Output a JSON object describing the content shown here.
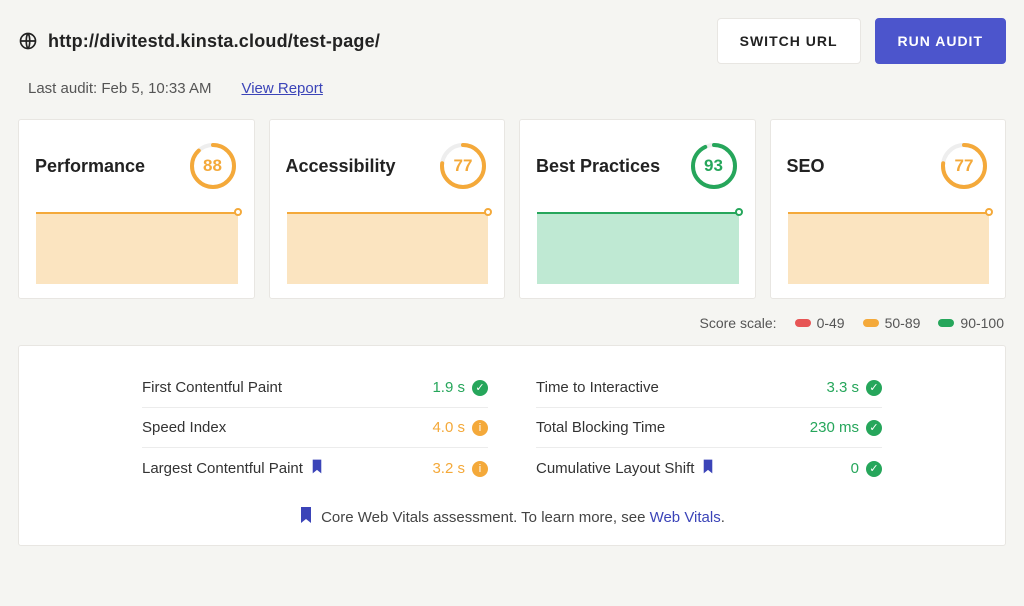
{
  "header": {
    "url": "http://divitestd.kinsta.cloud/test-page/",
    "switch_url_label": "SWITCH URL",
    "run_audit_label": "RUN AUDIT"
  },
  "subheader": {
    "last_audit_prefix": "Last audit: ",
    "last_audit_time": "Feb 5, 10:33 AM",
    "view_report_label": "View Report"
  },
  "cards": [
    {
      "title": "Performance",
      "score": 88,
      "tone": "orange"
    },
    {
      "title": "Accessibility",
      "score": 77,
      "tone": "orange"
    },
    {
      "title": "Best Practices",
      "score": 93,
      "tone": "green"
    },
    {
      "title": "SEO",
      "score": 77,
      "tone": "orange"
    }
  ],
  "legend": {
    "label": "Score scale:",
    "items": [
      {
        "range": "0-49",
        "color": "red"
      },
      {
        "range": "50-89",
        "color": "orange"
      },
      {
        "range": "90-100",
        "color": "green"
      }
    ]
  },
  "metrics": {
    "left": [
      {
        "name": "First Contentful Paint",
        "value": "1.9 s",
        "tone": "green",
        "status": "ok",
        "flag": false
      },
      {
        "name": "Speed Index",
        "value": "4.0 s",
        "tone": "orange",
        "status": "warn",
        "flag": false
      },
      {
        "name": "Largest Contentful Paint",
        "value": "3.2 s",
        "tone": "orange",
        "status": "warn",
        "flag": true
      }
    ],
    "right": [
      {
        "name": "Time to Interactive",
        "value": "3.3 s",
        "tone": "green",
        "status": "ok",
        "flag": false
      },
      {
        "name": "Total Blocking Time",
        "value": "230 ms",
        "tone": "green",
        "status": "ok",
        "flag": false
      },
      {
        "name": "Cumulative Layout Shift",
        "value": "0",
        "tone": "green",
        "status": "ok",
        "flag": true
      }
    ]
  },
  "footer": {
    "text_prefix": "Core Web Vitals assessment. To learn more, see ",
    "link_label": "Web Vitals",
    "text_suffix": "."
  },
  "colors": {
    "orange": "#f4a93a",
    "green": "#26a65b"
  }
}
